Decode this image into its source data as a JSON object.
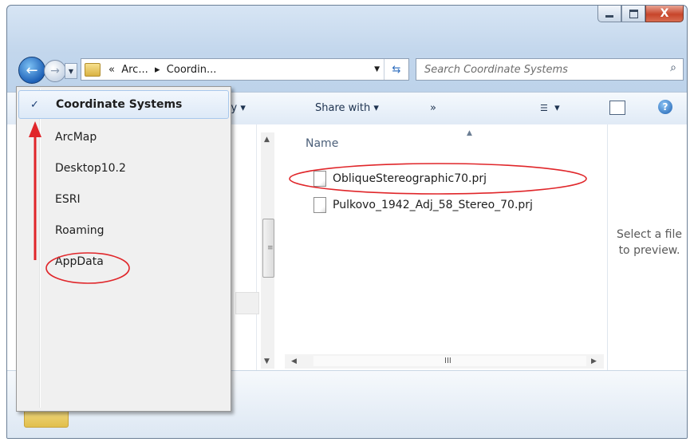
{
  "window": {
    "buttons": {
      "minimize": "minimize",
      "maximize": "maximize",
      "close": "X"
    }
  },
  "nav": {
    "back_icon": "back-arrow-icon",
    "forward_icon": "forward-arrow-icon"
  },
  "address": {
    "prefix": "«",
    "crumb1": "Arc...",
    "separator": "▸",
    "crumb2": "Coordin..."
  },
  "search": {
    "placeholder": "Search Coordinate Systems"
  },
  "toolbar": {
    "library_label": "ibrary ▾",
    "share_label": "Share with ▾",
    "more_label": "»",
    "views_label": "▾",
    "help_label": "?"
  },
  "file_list": {
    "column_name": "Name",
    "files": [
      {
        "name": "ObliqueStereographic70.prj"
      },
      {
        "name": "Pulkovo_1942_Adj_58_Stereo_70.prj"
      }
    ]
  },
  "preview": {
    "line1": "Select a file",
    "line2": "to preview."
  },
  "scrollbar": {
    "h_grip": "III",
    "v_grip": "≡"
  },
  "history_menu": {
    "checkmark": "✓",
    "items": [
      {
        "label": "Coordinate Systems",
        "selected": true
      },
      {
        "label": "ArcMap",
        "selected": false
      },
      {
        "label": "Desktop10.2",
        "selected": false
      },
      {
        "label": "ESRI",
        "selected": false
      },
      {
        "label": "Roaming",
        "selected": false
      },
      {
        "label": "AppData",
        "selected": false
      }
    ]
  },
  "colors": {
    "annotation_red": "#e0262a",
    "selection_border": "#a8c8ec",
    "link_blue": "#1e3350"
  }
}
